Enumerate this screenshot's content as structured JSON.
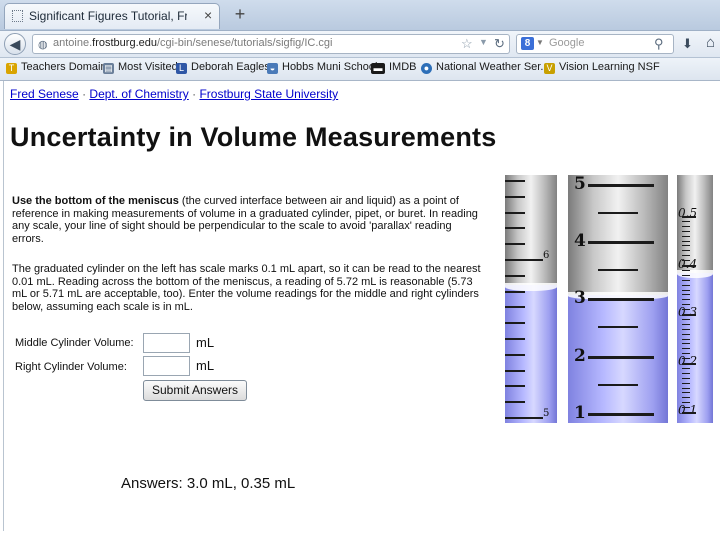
{
  "browser": {
    "tab_title": "Significant Figures Tutorial, Frame IC",
    "tab_close": "×",
    "new_tab": "+",
    "back": "◀",
    "url_prefix": "antoine.",
    "url_domain": "frostburg.edu",
    "url_path": "/cgi-bin/senese/tutorials/sigfig/IC.cgi",
    "search_placeholder": "Google",
    "search_engine_letter": "8"
  },
  "bookmarks": [
    {
      "label": "Teachers Domain",
      "icon": "teachers-domain-icon",
      "color": "#d9a400"
    },
    {
      "label": "Most Visited",
      "icon": "most-visited-icon",
      "color": "#6a7f9a"
    },
    {
      "label": "Deborah Eagles",
      "icon": "deborah-eagles-icon",
      "color": "#2f57a6"
    },
    {
      "label": "Hobbs Muni Schools",
      "icon": "hobbs-schools-icon",
      "color": "#4a7ab8"
    },
    {
      "label": "IMDB",
      "icon": "imdb-icon",
      "color": "#1a1a1a"
    },
    {
      "label": "National Weather Ser...",
      "icon": "weather-icon",
      "color": "#2d6fb8"
    },
    {
      "label": "Vision Learning NSF",
      "icon": "vision-learning-icon",
      "color": "#c8a000"
    }
  ],
  "page": {
    "links": [
      "Fred Senese",
      "Dept. of Chemistry",
      "Frostburg State University"
    ],
    "link_separator": "·",
    "title": "Uncertainty in Volume Measurements",
    "intro_bold": "Use the bottom of the meniscus",
    "intro_rest": " (the curved interface between air and liquid) as a point of reference in making measurements of volume in a graduated cylinder, pipet, or buret. In reading any scale, your line of sight should be perpendicular to the scale to avoid 'parallax' reading errors.",
    "para2": "The graduated cylinder on the left has scale marks 0.1 mL apart, so it can be read to the nearest 0.01 mL. Reading across the bottom of the meniscus, a reading of 5.72 mL is reasonable (5.73 mL or 5.71 mL are acceptable, too). Enter the volume readings for the middle and right cylinders below, assuming each scale is in mL.",
    "middle_label": "Middle Cylinder Volume:",
    "right_label": "Right Cylinder Volume:",
    "unit": "mL",
    "middle_value": "",
    "right_value": "",
    "submit_label": "Submit Answers",
    "answers_text": "Answers:   3.0 mL, 0.35 mL"
  },
  "cylinders": {
    "left_labels": [
      "6",
      "5"
    ],
    "middle_labels": [
      "5",
      "4",
      "3",
      "2",
      "1"
    ],
    "right_labels": [
      "0.5",
      "0.4",
      "0.3",
      "0.2",
      "0.1"
    ],
    "middle_reading": 3.0,
    "right_reading": 0.35,
    "liquid_color": "#b6b8ff"
  }
}
